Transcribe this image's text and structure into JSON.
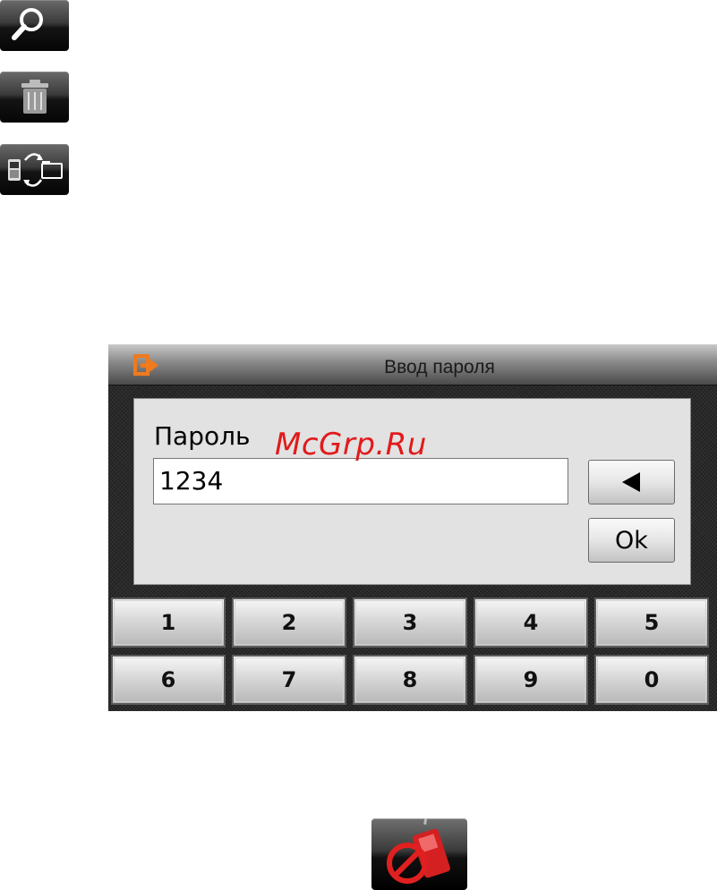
{
  "icons": {
    "search": "search-icon",
    "delete": "trash-icon",
    "sync": "phone-sync-icon",
    "exit": "exit-icon",
    "blocked": "blocked-phone-icon"
  },
  "dialog": {
    "title": "Ввод пароля",
    "password_label": "Пароль",
    "password_value": "1234",
    "ok_label": "Ok",
    "backspace_symbol": "◀"
  },
  "keypad": {
    "row1": [
      "1",
      "2",
      "3",
      "4",
      "5"
    ],
    "row2": [
      "6",
      "7",
      "8",
      "9",
      "0"
    ]
  },
  "watermark": "McGrp.Ru",
  "colors": {
    "accent_orange": "#f07a1e",
    "watermark_red": "#e11b1b",
    "blocked_red": "#e02020"
  }
}
